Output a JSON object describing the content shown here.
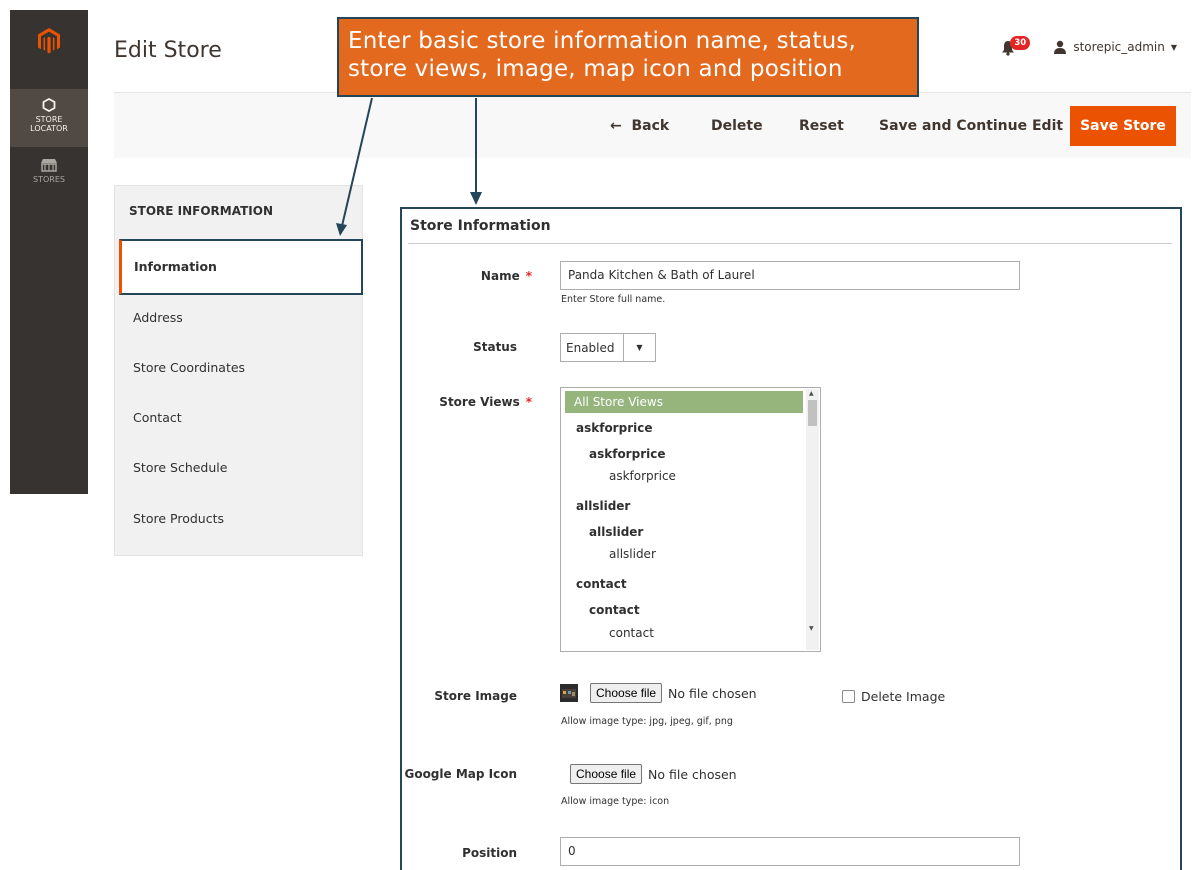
{
  "sidebar": {
    "items": [
      {
        "label_line1": "STORE",
        "label_line2": "LOCATOR",
        "icon": "hexagon-icon"
      },
      {
        "label_line1": "STORES",
        "label_line2": "",
        "icon": "store-icon"
      }
    ]
  },
  "header": {
    "title": "Edit Store",
    "notifications_count": "30",
    "username": "storepic_admin"
  },
  "actions": {
    "back": "Back",
    "delete": "Delete",
    "reset": "Reset",
    "save_continue": "Save and Continue Edit",
    "save": "Save Store"
  },
  "callout": {
    "line1": "Enter basic store information name, status,",
    "line2": "store views, image, map icon and position"
  },
  "tabs": {
    "title": "STORE INFORMATION",
    "items": [
      "Information",
      "Address",
      "Store Coordinates",
      "Contact",
      "Store Schedule",
      "Store Products"
    ]
  },
  "form": {
    "section_title": "Store Information",
    "name_label": "Name",
    "name_value": "Panda Kitchen & Bath of Laurel",
    "name_note": "Enter Store full name.",
    "status_label": "Status",
    "status_value": "Enabled",
    "store_views_label": "Store Views",
    "store_views_options": [
      "All Store Views",
      "askforprice",
      "askforprice",
      "askforprice",
      "allslider",
      "allslider",
      "allslider",
      "contact",
      "contact",
      "contact"
    ],
    "store_image_label": "Store Image",
    "choose_file": "Choose file",
    "no_file": "No file chosen",
    "delete_image": "Delete Image",
    "store_image_note": "Allow image type: jpg, jpeg, gif, png",
    "map_icon_label": "Google Map Icon",
    "map_icon_note": "Allow image type: icon",
    "position_label": "Position",
    "position_value": "0"
  },
  "colors": {
    "accent": "#eb5202",
    "callout": "#e2691e",
    "frame": "#23465a",
    "selected_option": "#95b57d"
  }
}
